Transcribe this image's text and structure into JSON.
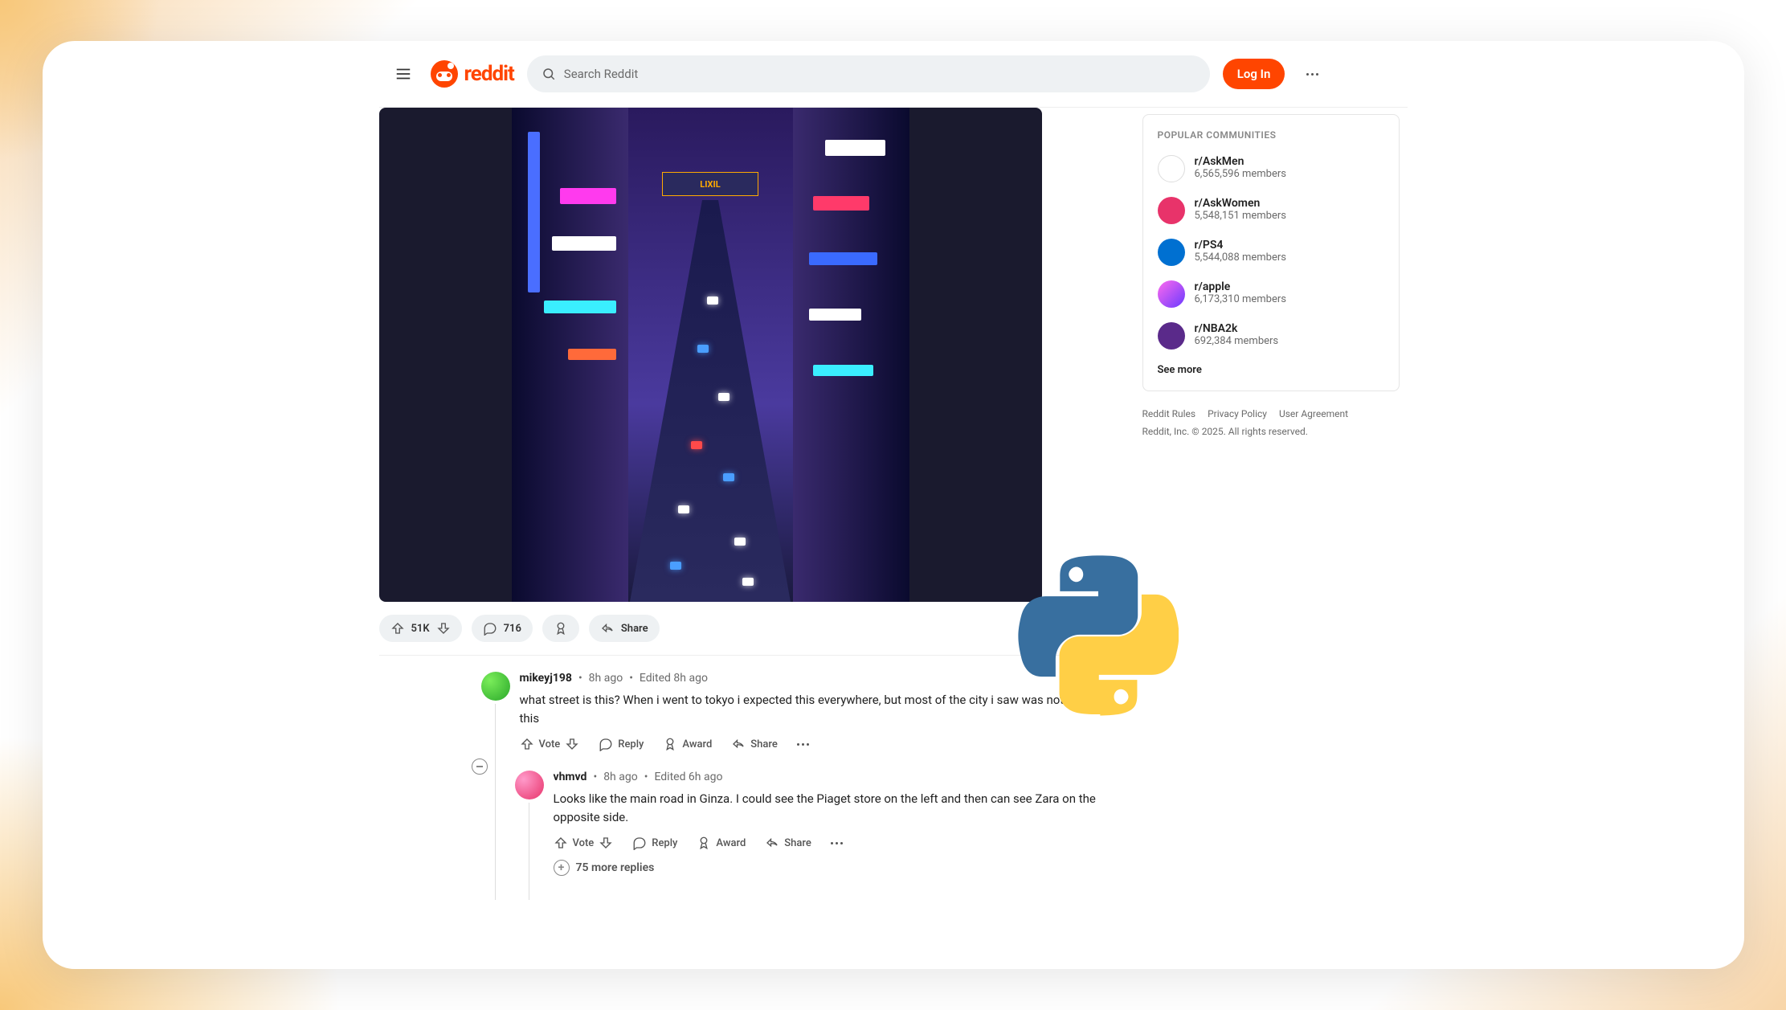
{
  "header": {
    "logo_text": "reddit",
    "search_placeholder": "Search Reddit",
    "login_label": "Log In"
  },
  "post": {
    "image_sign": "LIXIL",
    "vote_count": "51K",
    "comment_count": "716",
    "share_label": "Share"
  },
  "comments": [
    {
      "user": "mikeyj198",
      "time": "8h ago",
      "edited": "Edited 8h ago",
      "body": "what street is this? When i went to tokyo i expected this everywhere, but most of the city i saw was nothing like this",
      "vote_label": "Vote",
      "reply_label": "Reply",
      "award_label": "Award",
      "share_label": "Share"
    },
    {
      "user": "vhmvd",
      "time": "8h ago",
      "edited": "Edited 6h ago",
      "body": "Looks like the main road in Ginza. I could see the Piaget store on the left and then can see Zara on the opposite side.",
      "vote_label": "Vote",
      "reply_label": "Reply",
      "award_label": "Award",
      "share_label": "Share",
      "more_replies": "75 more replies"
    }
  ],
  "sidebar": {
    "title": "POPULAR COMMUNITIES",
    "communities": [
      {
        "name": "r/AskMen",
        "members": "6,565,596 members"
      },
      {
        "name": "r/AskWomen",
        "members": "5,548,151 members"
      },
      {
        "name": "r/PS4",
        "members": "5,544,088 members"
      },
      {
        "name": "r/apple",
        "members": "6,173,310 members"
      },
      {
        "name": "r/NBA2k",
        "members": "692,384 members"
      }
    ],
    "see_more": "See more"
  },
  "footer": {
    "rules": "Reddit Rules",
    "privacy": "Privacy Policy",
    "agreement": "User Agreement",
    "copyright": "Reddit, Inc. © 2025. All rights reserved."
  }
}
